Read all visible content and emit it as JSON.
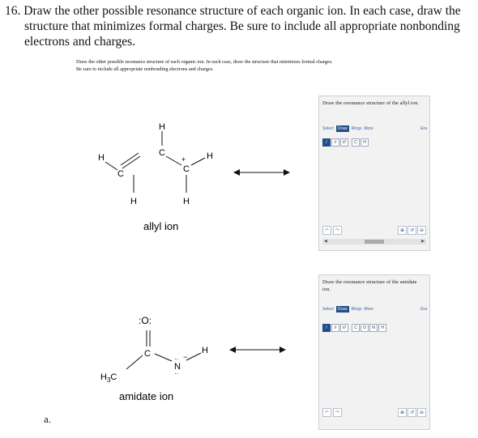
{
  "question": {
    "number": "16.",
    "line1": "Draw the other possible resonance structure of each organic ion. In each case, draw the",
    "line2": "structure that minimizes formal charges. Be sure to include all appropriate nonbonding",
    "line3": "electrons and charges."
  },
  "inner_prompt": {
    "line1": "Draw the other possible resonance structure of each organic ion. In each case, draw the structure that minimizes formal charges.",
    "line2": "Be sure to include all appropriate nonbonding electrons and charges."
  },
  "molecules": {
    "allyl": {
      "caption": "allyl ion",
      "H_top": "H",
      "H_left": "H",
      "H_right": "H",
      "H_bottom_left": "H",
      "H_bottom_right": "H",
      "C1": "C",
      "C2": "C",
      "C3": "C",
      "charge": "+"
    },
    "amidate": {
      "caption": "amidate ion",
      "O": ":O:",
      "C": "C",
      "H3C_H": "H",
      "H3C_C": "C",
      "H3C_sub": "3",
      "N": "N",
      "H": "H",
      "charge": "−"
    }
  },
  "panels": [
    {
      "title": "Draw the resonance structure of the allyl ion.",
      "tabs": [
        "Select",
        "Draw",
        "Rings",
        "More"
      ],
      "erase": "Era",
      "atoms": [
        "C",
        "H"
      ]
    },
    {
      "title": "Draw the resonance structure of the amidate ion.",
      "tabs": [
        "Select",
        "Draw",
        "Rings",
        "More"
      ],
      "erase": "Era",
      "atoms": [
        "C",
        "O",
        "N",
        "H"
      ]
    }
  ],
  "tools": {
    "single": "/",
    "double": "//",
    "triple": "///"
  },
  "icons": {
    "undo": "undo-icon",
    "redo": "redo-icon",
    "zoom_in": "zoom-in-icon",
    "reset": "reset-zoom-icon",
    "zoom_out": "zoom-out-icon"
  },
  "sub_label": "a.",
  "accent_color": "#1f4e8a"
}
